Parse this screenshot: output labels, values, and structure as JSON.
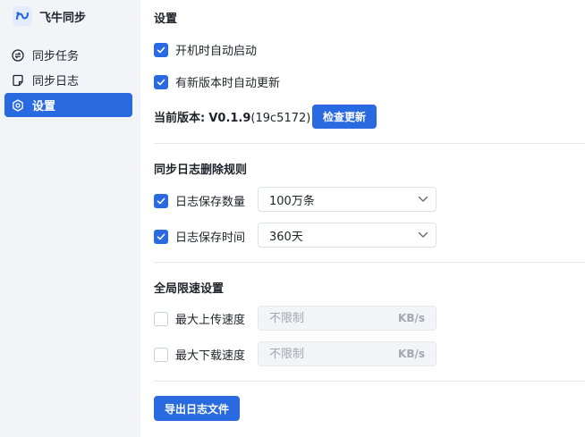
{
  "app": {
    "name": "飞牛同步"
  },
  "sidebar": {
    "items": [
      {
        "label": "同步任务",
        "icon": "sync-icon",
        "active": false
      },
      {
        "label": "同步日志",
        "icon": "note-icon",
        "active": false
      },
      {
        "label": "设置",
        "icon": "gear-icon",
        "active": true
      }
    ]
  },
  "settings": {
    "title": "设置",
    "autostart": {
      "label": "开机时自动启动",
      "checked": true
    },
    "autoupdate": {
      "label": "有新版本时自动更新",
      "checked": true
    },
    "version": {
      "label": "当前版本:",
      "value": "V0.1.9",
      "build": "(19c5172)"
    },
    "check_update_label": "检查更新"
  },
  "log_rules": {
    "title": "同步日志删除规则",
    "count": {
      "label": "日志保存数量",
      "checked": true,
      "value": "100万条"
    },
    "time": {
      "label": "日志保存时间",
      "checked": true,
      "value": "360天"
    }
  },
  "speed": {
    "title": "全局限速设置",
    "upload": {
      "label": "最大上传速度",
      "checked": false,
      "placeholder": "不限制",
      "unit": "KB/s"
    },
    "download": {
      "label": "最大下载速度",
      "checked": false,
      "placeholder": "不限制",
      "unit": "KB/s"
    }
  },
  "export_label": "导出日志文件",
  "colors": {
    "accent": "#2a6ae0",
    "sidebar_bg": "#f2f4f7",
    "disabled_bg": "#f2f4f7"
  }
}
